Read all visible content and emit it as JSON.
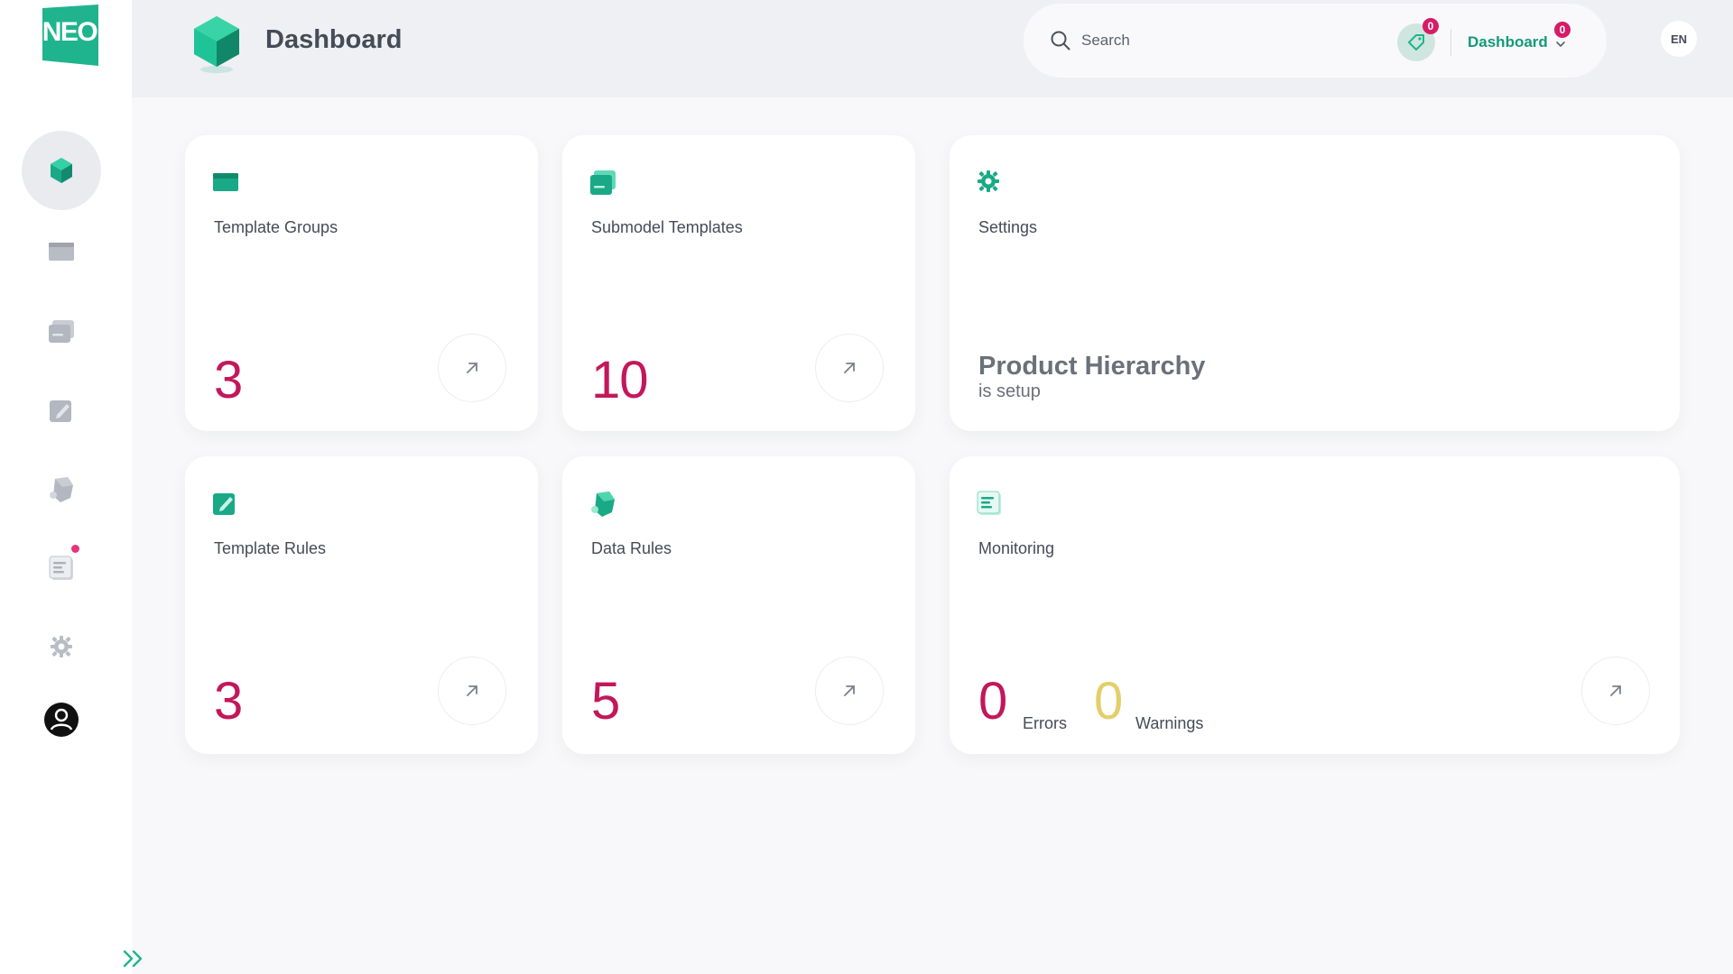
{
  "app": {
    "logo_text": "NEO",
    "brand_color": "#1fb48e"
  },
  "sidebar": {
    "items": [
      {
        "name": "dashboard",
        "icon": "gem-icon",
        "active": true
      },
      {
        "name": "template-groups",
        "icon": "folder-icon",
        "active": false
      },
      {
        "name": "submodel-templates",
        "icon": "stack-icon",
        "active": false
      },
      {
        "name": "template-rules",
        "icon": "edit-icon",
        "active": false
      },
      {
        "name": "data-rules",
        "icon": "cube-icon",
        "active": false
      },
      {
        "name": "monitoring",
        "icon": "list-icon",
        "active": false,
        "notification_dot": true
      },
      {
        "name": "settings",
        "icon": "gear-icon",
        "active": false
      },
      {
        "name": "profile",
        "icon": "user-icon",
        "active": false
      }
    ],
    "expand_icon": "double-chevron-right-icon"
  },
  "header": {
    "title": "Dashboard",
    "search": {
      "placeholder": "Search",
      "value": ""
    },
    "tag_badge": "0",
    "dropdown": {
      "label": "Dashboard",
      "badge": "0"
    },
    "language": "EN"
  },
  "cards": {
    "template_groups": {
      "title": "Template Groups",
      "value": "3"
    },
    "submodel_templates": {
      "title": "Submodel Templates",
      "value": "10"
    },
    "settings": {
      "title": "Settings",
      "status_title": "Product Hierarchy",
      "status_sub": "is setup"
    },
    "template_rules": {
      "title": "Template Rules",
      "value": "3"
    },
    "data_rules": {
      "title": "Data Rules",
      "value": "5"
    },
    "monitoring": {
      "title": "Monitoring",
      "errors_value": "0",
      "errors_label": "Errors",
      "warnings_value": "0",
      "warnings_label": "Warnings"
    }
  },
  "colors": {
    "accent": "#1fb48e",
    "value": "#c2185b",
    "warning": "#e3cf6a",
    "badge": "#d81b67"
  }
}
